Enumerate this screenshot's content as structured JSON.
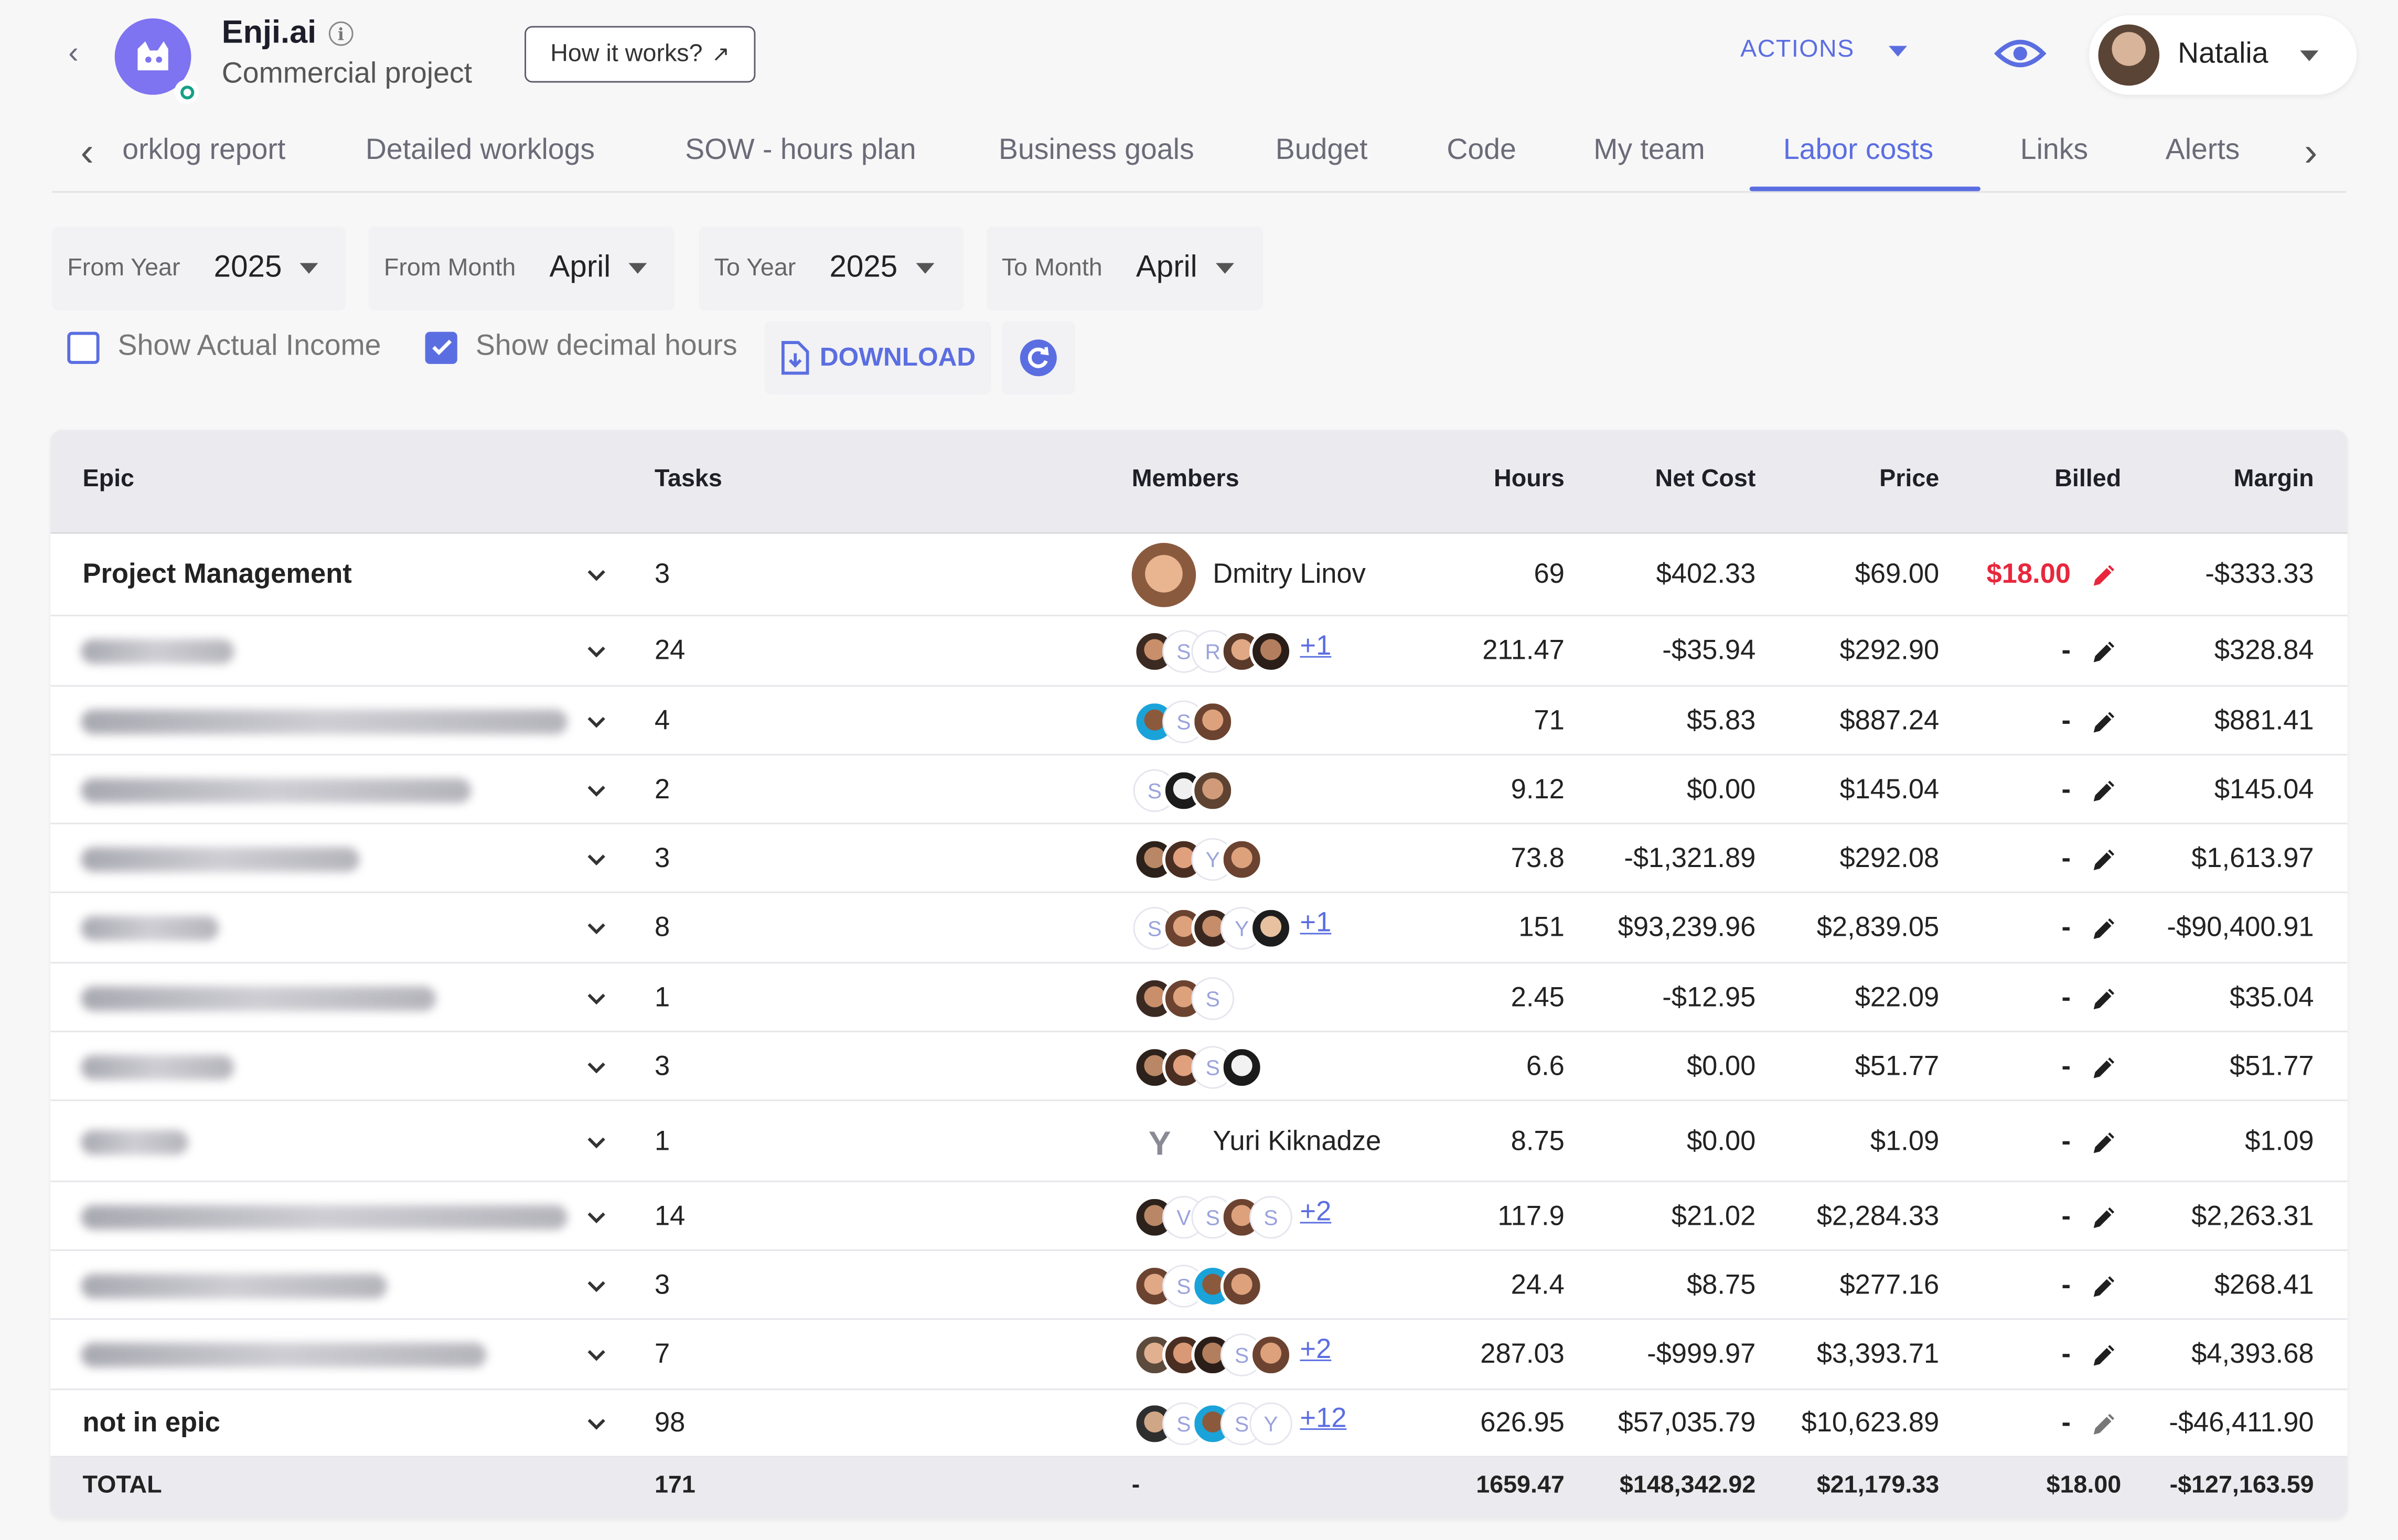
{
  "header": {
    "back_icon": "chevron-left-icon",
    "app_name": "Enji.ai",
    "project_type": "Commercial project",
    "how_label": "How it works?",
    "how_icon": "↗",
    "actions_label": "ACTIONS",
    "user_name": "Natalia"
  },
  "tabs": {
    "items": [
      "orklog report",
      "Detailed worklogs",
      "SOW - hours plan",
      "Business goals",
      "Budget",
      "Code",
      "My team",
      "Labor costs",
      "Links",
      "Alerts"
    ],
    "active": "Labor costs"
  },
  "filters": {
    "from_year_label": "From Year",
    "from_year": "2025",
    "from_month_label": "From Month",
    "from_month": "April",
    "to_year_label": "To Year",
    "to_year": "2025",
    "to_month_label": "To Month",
    "to_month": "April"
  },
  "options": {
    "show_actual_income": "Show Actual Income",
    "show_actual_income_checked": false,
    "show_decimal_hours": "Show decimal hours",
    "show_decimal_hours_checked": true,
    "download_label": "DOWNLOAD"
  },
  "table": {
    "columns": {
      "epic": "Epic",
      "tasks": "Tasks",
      "members": "Members",
      "hours": "Hours",
      "net_cost": "Net Cost",
      "price": "Price",
      "billed": "Billed",
      "margin": "Margin"
    },
    "rows": [
      {
        "epic": "Project Management",
        "tasks": "3",
        "member_name": "Dmitry Linov",
        "extra": "",
        "hours": "69",
        "net_cost": "$402.33",
        "price": "$69.00",
        "billed": "$18.00",
        "margin": "-$333.33"
      },
      {
        "epic": "",
        "tasks": "24",
        "member_name": "",
        "extra": "+1",
        "hours": "211.47",
        "net_cost": "-$35.94",
        "price": "$292.90",
        "billed": "-",
        "margin": "$328.84"
      },
      {
        "epic": "",
        "tasks": "4",
        "member_name": "",
        "extra": "",
        "hours": "71",
        "net_cost": "$5.83",
        "price": "$887.24",
        "billed": "-",
        "margin": "$881.41"
      },
      {
        "epic": "",
        "tasks": "2",
        "member_name": "",
        "extra": "",
        "hours": "9.12",
        "net_cost": "$0.00",
        "price": "$145.04",
        "billed": "-",
        "margin": "$145.04"
      },
      {
        "epic": "",
        "tasks": "3",
        "member_name": "",
        "extra": "",
        "hours": "73.8",
        "net_cost": "-$1,321.89",
        "price": "$292.08",
        "billed": "-",
        "margin": "$1,613.97"
      },
      {
        "epic": "",
        "tasks": "8",
        "member_name": "",
        "extra": "+1",
        "hours": "151",
        "net_cost": "$93,239.96",
        "price": "$2,839.05",
        "billed": "-",
        "margin": "-$90,400.91"
      },
      {
        "epic": "",
        "tasks": "1",
        "member_name": "",
        "extra": "",
        "hours": "2.45",
        "net_cost": "-$12.95",
        "price": "$22.09",
        "billed": "-",
        "margin": "$35.04"
      },
      {
        "epic": "",
        "tasks": "3",
        "member_name": "",
        "extra": "",
        "hours": "6.6",
        "net_cost": "$0.00",
        "price": "$51.77",
        "billed": "-",
        "margin": "$51.77"
      },
      {
        "epic": "",
        "tasks": "1",
        "member_name": "Yuri Kiknadze",
        "extra": "",
        "hours": "8.75",
        "net_cost": "$0.00",
        "price": "$1.09",
        "billed": "-",
        "margin": "$1.09"
      },
      {
        "epic": "",
        "tasks": "14",
        "member_name": "",
        "extra": "+2",
        "hours": "117.9",
        "net_cost": "$21.02",
        "price": "$2,284.33",
        "billed": "-",
        "margin": "$2,263.31"
      },
      {
        "epic": "",
        "tasks": "3",
        "member_name": "",
        "extra": "",
        "hours": "24.4",
        "net_cost": "$8.75",
        "price": "$277.16",
        "billed": "-",
        "margin": "$268.41"
      },
      {
        "epic": "",
        "tasks": "7",
        "member_name": "",
        "extra": "+2",
        "hours": "287.03",
        "net_cost": "-$999.97",
        "price": "$3,393.71",
        "billed": "-",
        "margin": "$4,393.68"
      },
      {
        "epic": "not in epic",
        "tasks": "98",
        "member_name": "",
        "extra": "+12",
        "hours": "626.95",
        "net_cost": "$57,035.79",
        "price": "$10,623.89",
        "billed": "-",
        "margin": "-$46,411.90"
      }
    ],
    "total": {
      "label": "TOTAL",
      "tasks": "171",
      "members": "-",
      "hours": "1659.47",
      "net_cost": "$148,342.92",
      "price": "$21,179.33",
      "billed": "$18.00",
      "margin": "-$127,163.59"
    }
  },
  "colors": {
    "accent": "#5b6ee1",
    "billed_red": "#e8273c",
    "logo": "#7e73f0",
    "online": "#16a085"
  }
}
